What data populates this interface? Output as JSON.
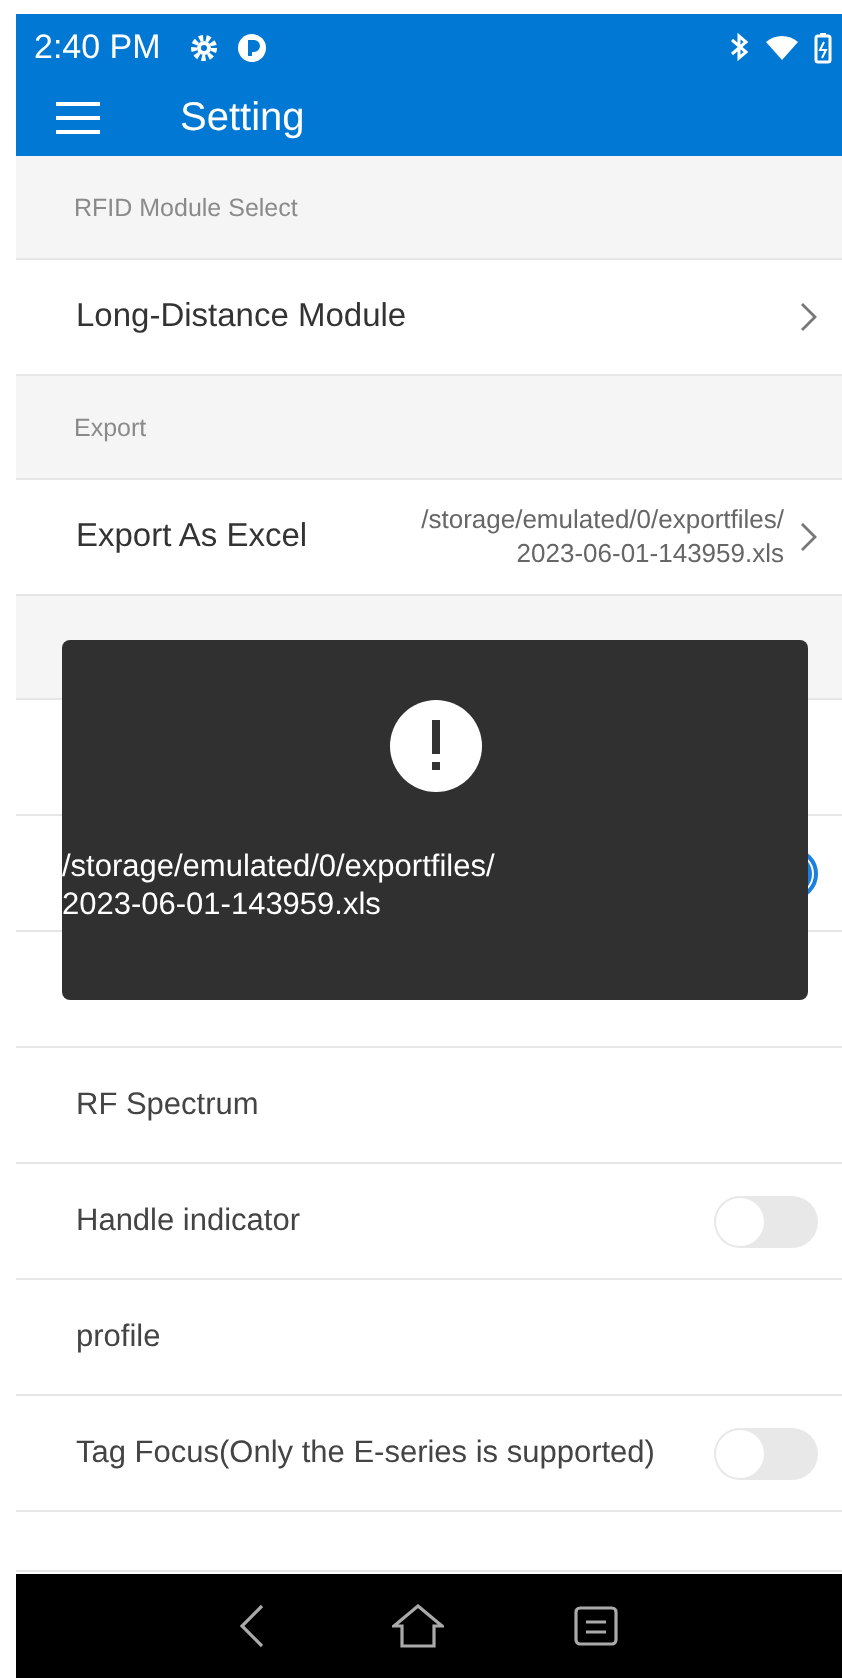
{
  "status_bar": {
    "time": "2:40 PM"
  },
  "app_bar": {
    "title": "Setting"
  },
  "items": [
    {
      "kind": "header",
      "label": "RFID Module Select"
    },
    {
      "kind": "link",
      "label": "Long-Distance Module"
    },
    {
      "kind": "header",
      "label": "Export"
    },
    {
      "kind": "link",
      "label": "Export As Excel",
      "value": "/storage/emulated/0/exportfiles/\n2023-06-01-143959.xls"
    },
    {
      "kind": "header"
    },
    {
      "kind": "plain"
    },
    {
      "kind": "switch",
      "on": true
    },
    {
      "kind": "plain"
    },
    {
      "kind": "plain",
      "label": "RF Spectrum"
    },
    {
      "kind": "switch",
      "label": "Handle indicator",
      "on": false
    },
    {
      "kind": "plain",
      "label": "profile"
    },
    {
      "kind": "switch",
      "label": "Tag Focus(Only the E-series is supported)",
      "on": false
    },
    {
      "kind": "partial"
    }
  ],
  "toast": {
    "message": "/storage/emulated/0/exportfiles/\n2023-06-01-143959.xls"
  }
}
